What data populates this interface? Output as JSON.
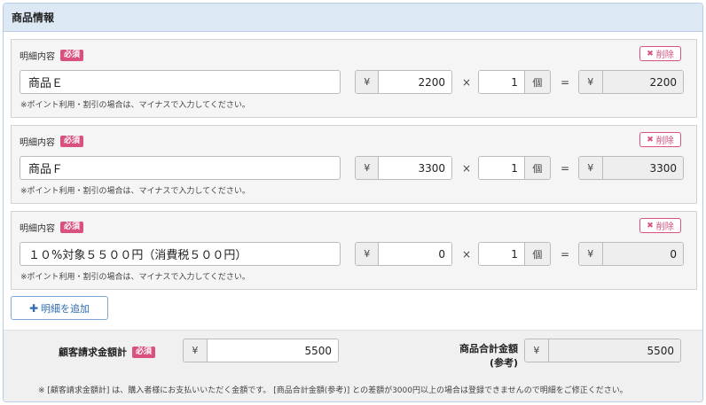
{
  "panel": {
    "title": "商品情報"
  },
  "items": [
    {
      "label": "明細内容",
      "badge": "必須",
      "delete": "削除",
      "name": "商品Ｅ",
      "note": "※ポイント利用・割引の場合は、マイナスで入力してください。",
      "currency": "¥",
      "price": "2200",
      "times": "×",
      "qty": "1",
      "unit": "個",
      "equals": "=",
      "total": "2200"
    },
    {
      "label": "明細内容",
      "badge": "必須",
      "delete": "削除",
      "name": "商品Ｆ",
      "note": "※ポイント利用・割引の場合は、マイナスで入力してください。",
      "currency": "¥",
      "price": "3300",
      "times": "×",
      "qty": "1",
      "unit": "個",
      "equals": "=",
      "total": "3300"
    },
    {
      "label": "明細内容",
      "badge": "必須",
      "delete": "削除",
      "name": "１０%対象５５００円（消費税５００円）",
      "note": "※ポイント利用・割引の場合は、マイナスで入力してください。",
      "currency": "¥",
      "price": "0",
      "times": "×",
      "qty": "1",
      "unit": "個",
      "equals": "=",
      "total": "0"
    }
  ],
  "add_button": "明細を追加",
  "footer": {
    "billing_label": "顧客請求金額計",
    "billing_badge": "必須",
    "billing_currency": "¥",
    "billing_value": "5500",
    "total_label_line1": "商品合計金額",
    "total_label_line2": "(参考)",
    "total_currency": "¥",
    "total_value": "5500",
    "note": "※ [顧客請求金額計] は、購入者様にお支払いいただく金額です。 [商品合計金額(参考)] との差額が3000円以上の場合は登録できませんので明細をご修正ください。"
  },
  "colors": {
    "accent_pink": "#d9527f",
    "header_bg": "#dde8f5",
    "link_blue": "#2f6cb0"
  }
}
